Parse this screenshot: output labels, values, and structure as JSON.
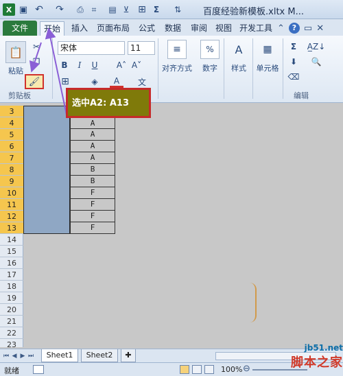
{
  "window": {
    "app_logo": "X",
    "title": "百度经验新模板.xltx M..."
  },
  "tabs": [
    "文件",
    "开始",
    "插入",
    "页面布局",
    "公式",
    "数据",
    "审阅",
    "视图",
    "开发工具"
  ],
  "help_symbol": "?",
  "ribbon": {
    "paste_label": "粘贴",
    "clipboard_group": "剪贴板",
    "font_name": "宋体",
    "font_size": "11",
    "bold": "B",
    "italic": "I",
    "underline": "U",
    "grow": "A˄",
    "shrink": "A˅",
    "font_color": "A",
    "wen": "文",
    "align_label": "对齐方式",
    "align_icon": "≡",
    "number_label": "数字",
    "number_icon": "%",
    "style_label": "样式",
    "style_icon": "A",
    "cells_label": "单元格",
    "sum": "Σ",
    "sort_filter": "A̲Z↓",
    "edit_group": "编辑"
  },
  "callout": "选中A2: A13",
  "rows": [
    "3",
    "4",
    "5",
    "6",
    "7",
    "8",
    "9",
    "10",
    "11",
    "12",
    "13",
    "14",
    "15",
    "16",
    "17",
    "18",
    "19",
    "20",
    "21",
    "22",
    "23"
  ],
  "selected_rows": [
    "3",
    "4",
    "5",
    "6",
    "7",
    "8",
    "9",
    "10",
    "11",
    "12",
    "13"
  ],
  "column_b": [
    "A",
    "A",
    "A",
    "A",
    "B",
    "B",
    "F",
    "F",
    "F",
    "F"
  ],
  "sheets": [
    "Sheet1",
    "Sheet2"
  ],
  "status": {
    "ready": "就绪",
    "zoom": "100%"
  },
  "watermark": {
    "url": "jb51.net",
    "name": "脚本之家"
  },
  "colors": {
    "file_tab": "#2b7a3d",
    "selection": "#8fa7c4",
    "callout_bg": "#7f7a0a",
    "callout_border": "#c62a2a",
    "row_highlight": "#f5c64e",
    "arrow": "#8a5fd6"
  }
}
